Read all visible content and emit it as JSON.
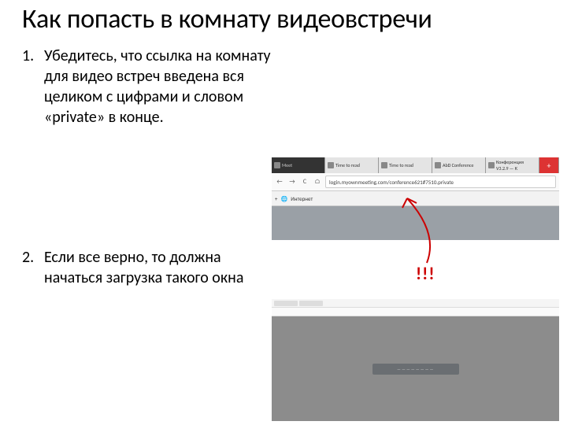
{
  "title": "Как попасть в комнату видеовстречи",
  "items": [
    {
      "num": "1.",
      "text": "Убедитесь, что ссылка на комнату для видео встреч введена вся целиком с цифрами и словом «private» в конце."
    },
    {
      "num": "2.",
      "text": "Если все верно, то должна начаться загрузка такого окна"
    }
  ],
  "exclaim": "!!!",
  "screenshot1": {
    "tabs": [
      {
        "label": "Meet",
        "dark": true
      },
      {
        "label": "Time to read"
      },
      {
        "label": "Time to read"
      },
      {
        "label": "AbD Conference"
      },
      {
        "label": "Конференция V3.2.9 — К"
      }
    ],
    "plus": "+",
    "nav_back": "←",
    "nav_fwd": "→",
    "nav_reload": "C",
    "nav_home": "⌂",
    "url": "login.myownmeeting.com/conference621#7510.private",
    "bookmark_plus": "+",
    "bookmark_label": "Интернет",
    "bookmark_icon": "🌐"
  },
  "screenshot2": {
    "loader_text": "――――――――"
  }
}
